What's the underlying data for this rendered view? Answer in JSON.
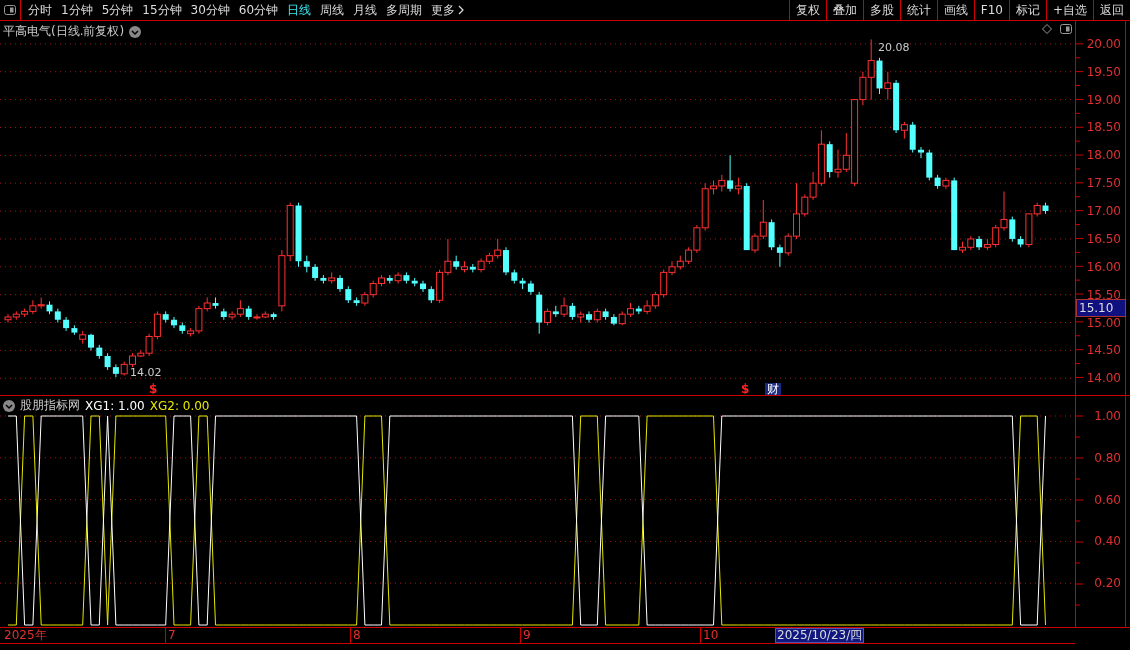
{
  "toolbar": {
    "periods": [
      {
        "label": "分时",
        "selected": false
      },
      {
        "label": "1分钟",
        "selected": false
      },
      {
        "label": "5分钟",
        "selected": false
      },
      {
        "label": "15分钟",
        "selected": false
      },
      {
        "label": "30分钟",
        "selected": false
      },
      {
        "label": "60分钟",
        "selected": false
      },
      {
        "label": "日线",
        "selected": true
      },
      {
        "label": "周线",
        "selected": false
      },
      {
        "label": "月线",
        "selected": false
      },
      {
        "label": "多周期",
        "selected": false
      }
    ],
    "more": "更多",
    "actions": [
      "复权",
      "叠加",
      "多股",
      "统计",
      "画线",
      "F10",
      "标记",
      "+自选",
      "返回"
    ]
  },
  "chart": {
    "title": "平高电气(日线.前复权)",
    "chart_data": {
      "type": "candlestick",
      "ylim": [
        13.7,
        20.41
      ],
      "yticks": [
        {
          "value": 20,
          "label": "20.00"
        },
        {
          "value": 19.5,
          "label": "19.50"
        },
        {
          "value": 19,
          "label": "19.00"
        },
        {
          "value": 18.5,
          "label": "18.50"
        },
        {
          "value": 18,
          "label": "18.00"
        },
        {
          "value": 17.5,
          "label": "17.50"
        },
        {
          "value": 17,
          "label": "17.00"
        },
        {
          "value": 16.5,
          "label": "16.50"
        },
        {
          "value": 16,
          "label": "16.00"
        },
        {
          "value": 15.5,
          "label": "15.50"
        },
        {
          "value": 15,
          "label": "15.00"
        },
        {
          "value": 14.5,
          "label": "14.50"
        },
        {
          "value": 14,
          "label": "14.00"
        }
      ],
      "grid": true,
      "ohlc": [
        [
          15.05,
          15.15,
          15.0,
          15.1
        ],
        [
          15.1,
          15.2,
          15.05,
          15.15
        ],
        [
          15.15,
          15.25,
          15.1,
          15.2
        ],
        [
          15.2,
          15.4,
          15.15,
          15.3
        ],
        [
          15.3,
          15.45,
          15.25,
          15.32
        ],
        [
          15.32,
          15.38,
          15.15,
          15.2
        ],
        [
          15.2,
          15.25,
          15.0,
          15.05
        ],
        [
          15.05,
          15.1,
          14.85,
          14.9
        ],
        [
          14.9,
          14.95,
          14.78,
          14.82
        ],
        [
          14.7,
          14.85,
          14.62,
          14.78
        ],
        [
          14.78,
          14.8,
          14.5,
          14.55
        ],
        [
          14.55,
          14.6,
          14.35,
          14.4
        ],
        [
          14.4,
          14.45,
          14.15,
          14.2
        ],
        [
          14.2,
          14.25,
          14.02,
          14.08
        ],
        [
          14.08,
          14.3,
          14.05,
          14.25
        ],
        [
          14.25,
          14.45,
          14.2,
          14.4
        ],
        [
          14.4,
          14.5,
          14.38,
          14.45
        ],
        [
          14.45,
          14.8,
          14.4,
          14.75
        ],
        [
          14.75,
          15.2,
          14.7,
          15.15
        ],
        [
          15.15,
          15.2,
          15.0,
          15.05
        ],
        [
          15.05,
          15.1,
          14.9,
          14.95
        ],
        [
          14.95,
          15.0,
          14.8,
          14.85
        ],
        [
          14.8,
          14.9,
          14.75,
          14.85
        ],
        [
          14.85,
          15.3,
          14.8,
          15.25
        ],
        [
          15.25,
          15.45,
          15.2,
          15.35
        ],
        [
          15.35,
          15.45,
          15.25,
          15.3
        ],
        [
          15.2,
          15.25,
          15.05,
          15.1
        ],
        [
          15.1,
          15.2,
          15.05,
          15.15
        ],
        [
          15.15,
          15.4,
          15.1,
          15.25
        ],
        [
          15.25,
          15.3,
          15.05,
          15.1
        ],
        [
          15.1,
          15.15,
          15.05,
          15.1
        ],
        [
          15.1,
          15.2,
          15.08,
          15.15
        ],
        [
          15.15,
          15.18,
          15.05,
          15.1
        ],
        [
          15.3,
          16.3,
          15.2,
          16.2
        ],
        [
          16.2,
          17.15,
          16.1,
          17.1
        ],
        [
          17.1,
          17.15,
          16.0,
          16.1
        ],
        [
          16.1,
          16.2,
          15.9,
          16.0
        ],
        [
          16.0,
          16.05,
          15.75,
          15.8
        ],
        [
          15.8,
          15.85,
          15.7,
          15.75
        ],
        [
          15.75,
          15.9,
          15.7,
          15.8
        ],
        [
          15.8,
          15.85,
          15.55,
          15.6
        ],
        [
          15.6,
          15.65,
          15.35,
          15.4
        ],
        [
          15.4,
          15.45,
          15.3,
          15.35
        ],
        [
          15.35,
          15.55,
          15.3,
          15.5
        ],
        [
          15.5,
          15.75,
          15.45,
          15.7
        ],
        [
          15.7,
          15.85,
          15.65,
          15.8
        ],
        [
          15.8,
          15.85,
          15.7,
          15.75
        ],
        [
          15.75,
          15.9,
          15.7,
          15.85
        ],
        [
          15.85,
          15.9,
          15.7,
          15.75
        ],
        [
          15.75,
          15.8,
          15.65,
          15.7
        ],
        [
          15.7,
          15.75,
          15.55,
          15.6
        ],
        [
          15.6,
          15.65,
          15.35,
          15.4
        ],
        [
          15.4,
          15.95,
          15.35,
          15.9
        ],
        [
          15.9,
          16.5,
          15.85,
          16.1
        ],
        [
          16.1,
          16.2,
          15.95,
          16.0
        ],
        [
          15.95,
          16.1,
          15.9,
          16.0
        ],
        [
          16.0,
          16.05,
          15.9,
          15.95
        ],
        [
          15.95,
          16.15,
          15.9,
          16.1
        ],
        [
          16.1,
          16.25,
          16.05,
          16.2
        ],
        [
          16.2,
          16.5,
          16.15,
          16.3
        ],
        [
          16.3,
          16.35,
          15.85,
          15.9
        ],
        [
          15.9,
          15.95,
          15.7,
          15.75
        ],
        [
          15.75,
          15.8,
          15.6,
          15.7
        ],
        [
          15.7,
          15.75,
          15.5,
          15.55
        ],
        [
          15.5,
          15.55,
          14.8,
          15.0
        ],
        [
          15.0,
          15.25,
          14.95,
          15.2
        ],
        [
          15.2,
          15.3,
          15.1,
          15.15
        ],
        [
          15.15,
          15.45,
          15.1,
          15.3
        ],
        [
          15.3,
          15.35,
          15.05,
          15.1
        ],
        [
          15.1,
          15.2,
          15.0,
          15.15
        ],
        [
          15.15,
          15.2,
          15.0,
          15.05
        ],
        [
          15.05,
          15.25,
          15.0,
          15.2
        ],
        [
          15.2,
          15.25,
          15.05,
          15.1
        ],
        [
          15.1,
          15.15,
          14.95,
          14.98
        ],
        [
          14.98,
          15.2,
          14.95,
          15.15
        ],
        [
          15.15,
          15.35,
          15.1,
          15.25
        ],
        [
          15.25,
          15.3,
          15.15,
          15.2
        ],
        [
          15.2,
          15.4,
          15.15,
          15.3
        ],
        [
          15.3,
          15.55,
          15.25,
          15.5
        ],
        [
          15.5,
          15.95,
          15.45,
          15.9
        ],
        [
          15.9,
          16.1,
          15.85,
          16.0
        ],
        [
          16.0,
          16.2,
          15.95,
          16.1
        ],
        [
          16.1,
          16.35,
          16.05,
          16.3
        ],
        [
          16.3,
          16.75,
          16.25,
          16.7
        ],
        [
          16.7,
          17.5,
          16.65,
          17.4
        ],
        [
          17.4,
          17.55,
          17.3,
          17.45
        ],
        [
          17.45,
          17.65,
          17.35,
          17.55
        ],
        [
          17.55,
          18.0,
          17.35,
          17.4
        ],
        [
          17.4,
          17.6,
          17.3,
          17.45
        ],
        [
          17.45,
          17.5,
          16.3,
          16.3
        ],
        [
          16.3,
          16.6,
          16.25,
          16.55
        ],
        [
          16.55,
          17.2,
          16.5,
          16.8
        ],
        [
          16.8,
          16.85,
          16.3,
          16.35
        ],
        [
          16.35,
          16.4,
          16.0,
          16.25
        ],
        [
          16.25,
          16.6,
          16.2,
          16.55
        ],
        [
          16.55,
          17.5,
          16.5,
          16.95
        ],
        [
          16.95,
          17.3,
          16.9,
          17.25
        ],
        [
          17.25,
          17.7,
          17.2,
          17.5
        ],
        [
          17.5,
          18.45,
          17.45,
          18.2
        ],
        [
          18.2,
          18.25,
          17.6,
          17.7
        ],
        [
          17.7,
          18.1,
          17.6,
          17.75
        ],
        [
          17.75,
          18.4,
          17.7,
          18.0
        ],
        [
          17.5,
          19.0,
          17.45,
          19.0
        ],
        [
          19.0,
          19.5,
          18.9,
          19.4
        ],
        [
          19.4,
          20.08,
          19.0,
          19.7
        ],
        [
          19.7,
          19.75,
          19.1,
          19.2
        ],
        [
          19.2,
          19.5,
          19.0,
          19.3
        ],
        [
          19.3,
          19.35,
          18.4,
          18.45
        ],
        [
          18.45,
          18.6,
          18.3,
          18.55
        ],
        [
          18.55,
          18.6,
          18.05,
          18.1
        ],
        [
          18.1,
          18.15,
          17.95,
          18.05
        ],
        [
          18.05,
          18.1,
          17.55,
          17.6
        ],
        [
          17.6,
          17.65,
          17.4,
          17.45
        ],
        [
          17.45,
          17.6,
          17.4,
          17.55
        ],
        [
          17.55,
          17.6,
          16.3,
          16.3
        ],
        [
          16.3,
          16.45,
          16.25,
          16.35
        ],
        [
          16.35,
          16.55,
          16.3,
          16.5
        ],
        [
          16.5,
          16.55,
          16.3,
          16.35
        ],
        [
          16.35,
          16.5,
          16.3,
          16.4
        ],
        [
          16.4,
          16.75,
          16.35,
          16.7
        ],
        [
          16.7,
          17.35,
          16.65,
          16.85
        ],
        [
          16.85,
          16.9,
          16.45,
          16.5
        ],
        [
          16.5,
          16.55,
          16.35,
          16.4
        ],
        [
          16.4,
          16.95,
          16.35,
          16.95
        ],
        [
          16.95,
          17.15,
          16.9,
          17.1
        ],
        [
          17.1,
          17.15,
          16.95,
          17.0
        ]
      ]
    },
    "current_price": "15.10",
    "high_label": "20.08",
    "low_label": "14.02",
    "event_marks": [
      {
        "kind": "dividend",
        "text": "$"
      },
      {
        "kind": "dividend",
        "text": "$"
      },
      {
        "kind": "finance",
        "text": "财"
      }
    ]
  },
  "indicator": {
    "name": "股朋指标网",
    "readings": [
      ": 1.00",
      ": 0.00"
    ],
    "chart_data": {
      "type": "line",
      "ylim": [
        0,
        1
      ],
      "grid": true,
      "yticks": [
        {
          "value": 1,
          "label": "1.00"
        },
        {
          "value": 0.8,
          "label": "0.80"
        },
        {
          "value": 0.6,
          "label": "0.60"
        },
        {
          "value": 0.4,
          "label": "0.40"
        },
        {
          "value": 0.2,
          "label": "0.20"
        }
      ],
      "series": [
        {
          "name": "XG1",
          "color": "#ffffff",
          "values": [
            1,
            1,
            0,
            0,
            1,
            1,
            1,
            1,
            1,
            1,
            0,
            0,
            1,
            0,
            0,
            0,
            0,
            0,
            0,
            0,
            1,
            1,
            1,
            0,
            0,
            1,
            1,
            1,
            1,
            1,
            1,
            1,
            1,
            1,
            1,
            1,
            1,
            1,
            1,
            1,
            1,
            1,
            1,
            0,
            0,
            0,
            1,
            1,
            1,
            1,
            1,
            1,
            1,
            1,
            1,
            1,
            1,
            1,
            1,
            1,
            1,
            1,
            1,
            1,
            1,
            1,
            1,
            1,
            1,
            0,
            0,
            0,
            1,
            1,
            1,
            1,
            1,
            0,
            0,
            0,
            0,
            0,
            0,
            0,
            0,
            0,
            1,
            1,
            1,
            1,
            1,
            1,
            1,
            1,
            1,
            1,
            1,
            1,
            1,
            1,
            1,
            1,
            1,
            1,
            1,
            1,
            1,
            1,
            1,
            1,
            1,
            1,
            1,
            1,
            1,
            1,
            1,
            1,
            1,
            1,
            1,
            1,
            0,
            0,
            0,
            1
          ]
        },
        {
          "name": "XG2",
          "color": "#e8e800",
          "values": [
            0,
            0,
            1,
            1,
            0,
            0,
            0,
            0,
            0,
            0,
            1,
            1,
            0,
            1,
            1,
            1,
            1,
            1,
            1,
            1,
            0,
            0,
            0,
            1,
            1,
            0,
            0,
            0,
            0,
            0,
            0,
            0,
            0,
            0,
            0,
            0,
            0,
            0,
            0,
            0,
            0,
            0,
            0,
            1,
            1,
            1,
            0,
            0,
            0,
            0,
            0,
            0,
            0,
            0,
            0,
            0,
            0,
            0,
            0,
            0,
            0,
            0,
            0,
            0,
            0,
            0,
            0,
            0,
            0,
            1,
            1,
            1,
            0,
            0,
            0,
            0,
            0,
            1,
            1,
            1,
            1,
            1,
            1,
            1,
            1,
            1,
            0,
            0,
            0,
            0,
            0,
            0,
            0,
            0,
            0,
            0,
            0,
            0,
            0,
            0,
            0,
            0,
            0,
            0,
            0,
            0,
            0,
            0,
            0,
            0,
            0,
            0,
            0,
            0,
            0,
            0,
            0,
            0,
            0,
            0,
            0,
            0,
            1,
            1,
            1,
            0
          ]
        }
      ]
    }
  },
  "date_axis": [
    "2025年",
    "7",
    "8",
    "9",
    "10"
  ],
  "cursor_date": "2025/10/23/四"
}
